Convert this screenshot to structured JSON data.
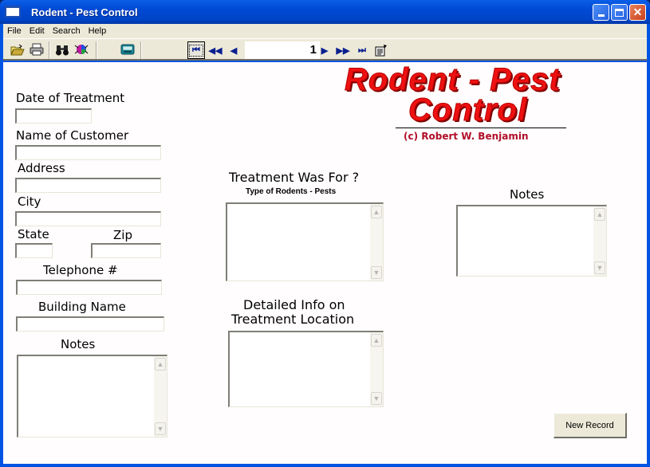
{
  "window": {
    "title": "Rodent - Pest Control",
    "controls": {
      "minimize": "minimize",
      "maximize": "maximize",
      "close": "✕"
    }
  },
  "menu": [
    "File",
    "Edit",
    "Search",
    "Help"
  ],
  "toolbar": {
    "icons": [
      "open-folder-icon",
      "print-icon",
      "find-binoculars-icon",
      "pest-icon",
      "calculator-icon"
    ],
    "navigator": {
      "first": "⏮",
      "prev_page": "◀◀",
      "prev": "◀",
      "record_number": "1",
      "next": "▶",
      "next_page": "▶▶",
      "last": "⏭",
      "properties_icon": "▦"
    }
  },
  "logo": {
    "line1": "Rodent - Pest",
    "line2": "Control",
    "credit": "(c) Robert W. Benjamin",
    "color": "#ee1111"
  },
  "form": {
    "date_of_treatment": {
      "label": "Date of Treatment",
      "value": ""
    },
    "name_of_customer": {
      "label": "Name of Customer",
      "value": ""
    },
    "address": {
      "label": "Address",
      "value": ""
    },
    "city": {
      "label": "City",
      "value": ""
    },
    "state": {
      "label": "State",
      "value": ""
    },
    "zip": {
      "label": "Zip",
      "value": ""
    },
    "telephone": {
      "label": "Telephone #",
      "value": ""
    },
    "building_name": {
      "label": "Building Name",
      "value": ""
    },
    "notes_left": {
      "label": "Notes",
      "value": ""
    },
    "treatment_for": {
      "label": "Treatment Was For ?",
      "sublabel": "Type of Rodents - Pests",
      "value": ""
    },
    "detailed_info": {
      "label_line1": "Detailed Info on",
      "label_line2": "Treatment Location",
      "value": ""
    },
    "notes_right": {
      "label": "Notes",
      "value": ""
    }
  },
  "buttons": {
    "new_record": "New Record"
  }
}
